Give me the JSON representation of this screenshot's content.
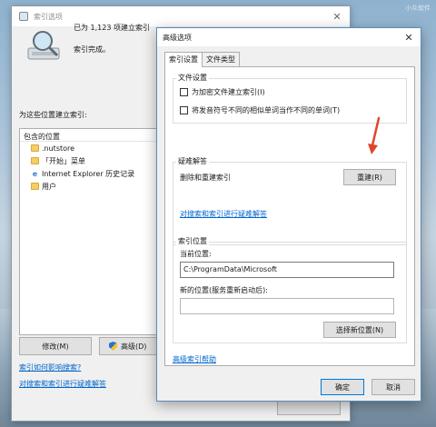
{
  "watermark": "小众软件",
  "index_options": {
    "title": "索引选项",
    "indexed_count": "已为 1,123 项建立索引",
    "status": "索引完成。",
    "build_for_label": "为这些位置建立索引:",
    "list_header": "包含的位置",
    "locations": [
      {
        "icon": "folder-icon",
        "label": ".nutstore"
      },
      {
        "icon": "folder-icon",
        "label": "「开始」菜单"
      },
      {
        "icon": "ie-icon",
        "label": "Internet Explorer 历史记录"
      },
      {
        "icon": "folder-icon",
        "label": "用户"
      }
    ],
    "modify_label": "修改(M)",
    "advanced_label": "高级(D)",
    "link_how": "索引如何影响搜索?",
    "link_troubleshoot": "对搜索和索引进行疑难解答"
  },
  "advanced_options": {
    "title": "高级选项",
    "tabs": [
      {
        "label": "索引设置",
        "active": true
      },
      {
        "label": "文件类型",
        "active": false
      }
    ],
    "file_settings_title": "文件设置",
    "checkbox_encrypt": "为加密文件建立索引(I)",
    "checkbox_diacritics": "将发音符号不同的相似单词当作不同的单词(T)",
    "troubleshoot_title": "疑难解答",
    "rebuild_text": "删除和重建索引",
    "rebuild_button": "重建(R)",
    "troubleshoot_link": "对搜索和索引进行疑难解答",
    "index_location_title": "索引位置",
    "current_location_label": "当前位置:",
    "current_location_value": "C:\\ProgramData\\Microsoft",
    "new_location_label": "新的位置(服务重新启动后):",
    "new_location_value": "",
    "select_new_location_button": "选择新位置(N)",
    "help_link": "高级索引帮助",
    "ok_button": "确定",
    "cancel_button": "取消"
  },
  "colors": {
    "link": "#0066cc",
    "annotation_arrow": "#e0452a",
    "dialog_border": "#5b8bb6"
  }
}
